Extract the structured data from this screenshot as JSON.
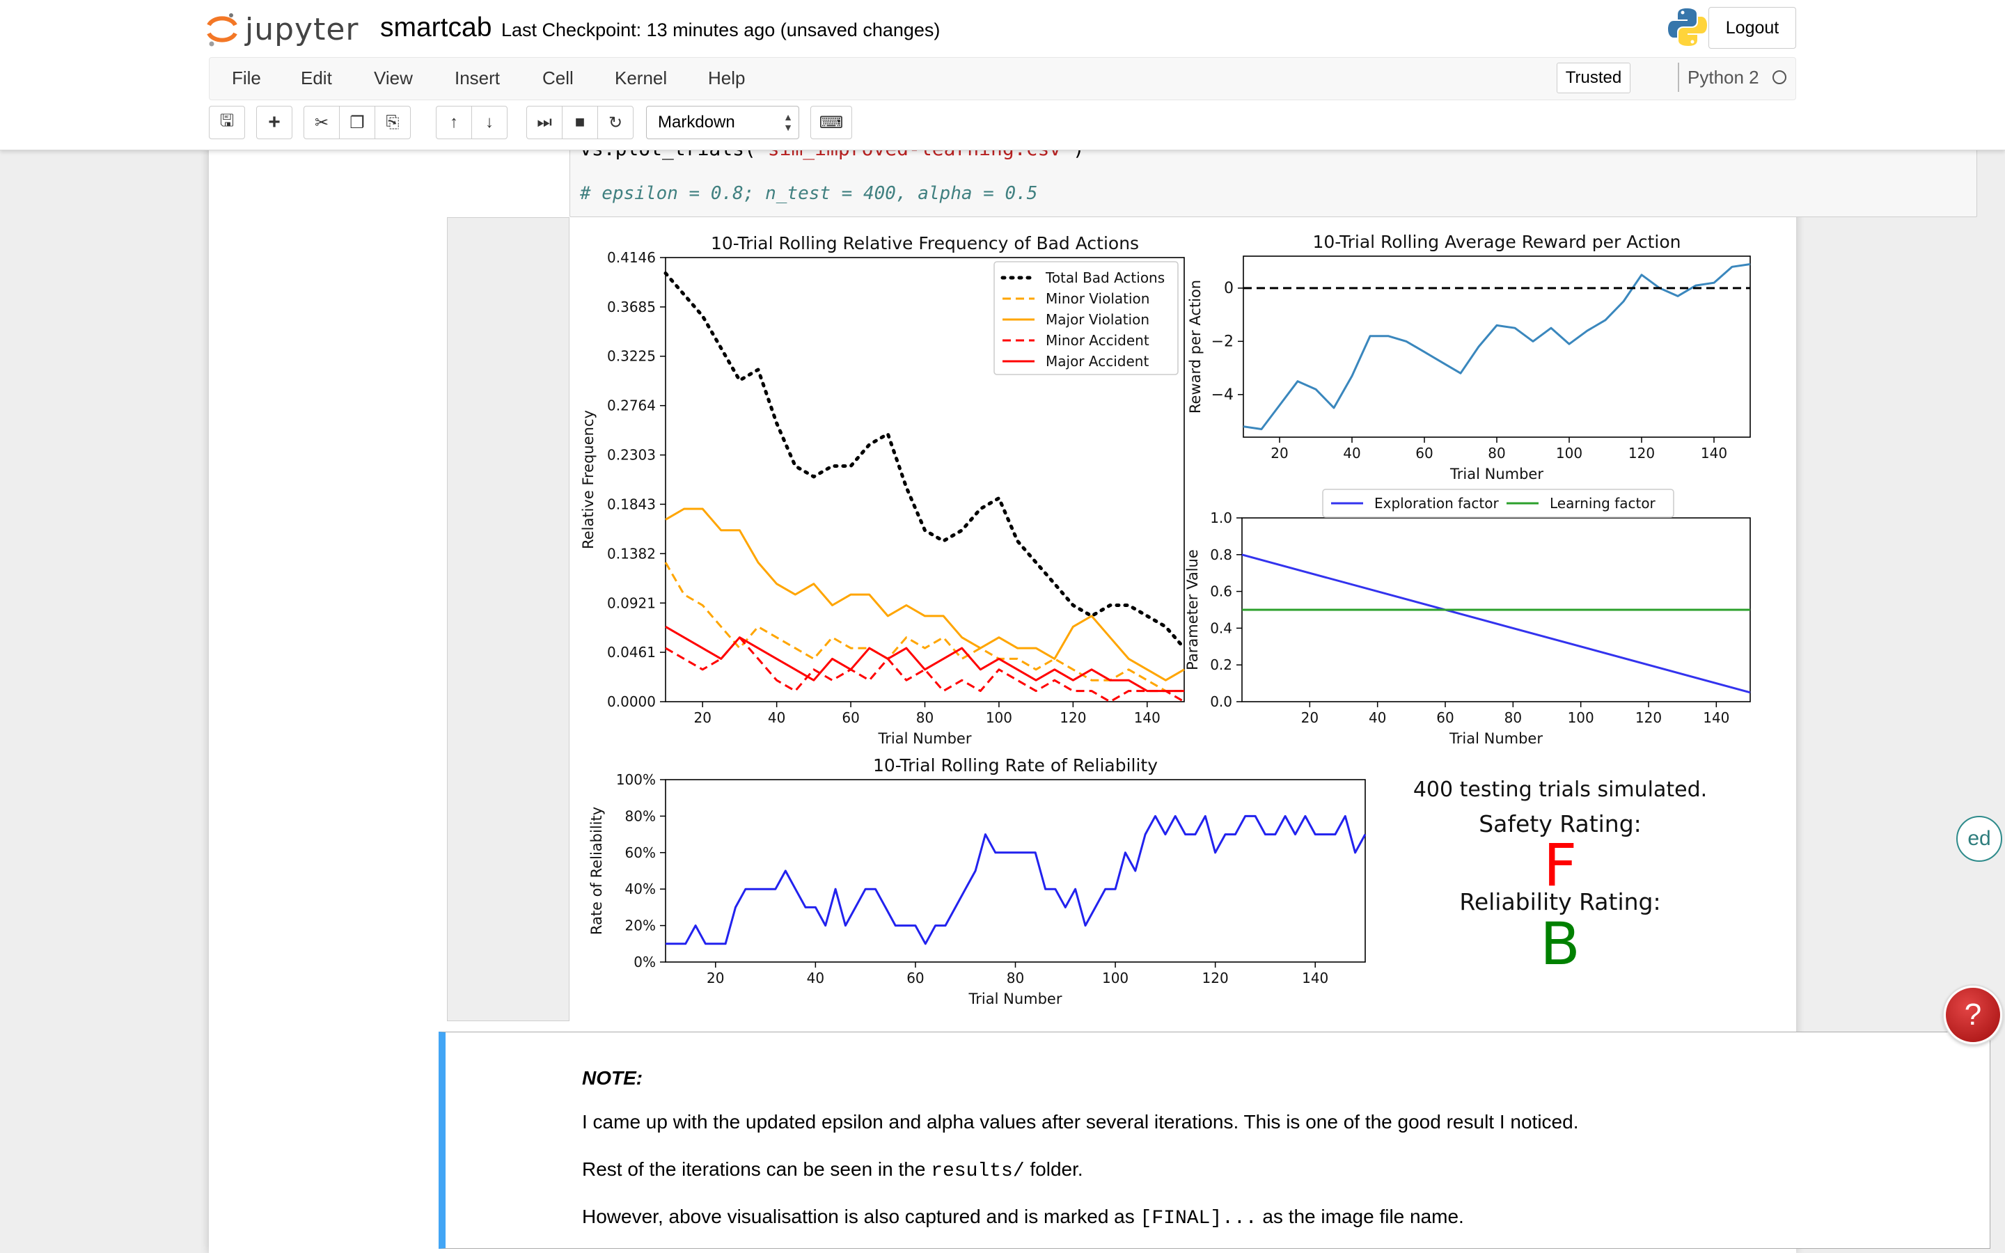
{
  "app": {
    "logo_text": "jupyter",
    "notebook_name": "smartcab",
    "checkpoint": "Last Checkpoint: 13 minutes ago (unsaved changes)",
    "logout_label": "Logout",
    "trusted_label": "Trusted",
    "kernel_name": "Python 2"
  },
  "menu": [
    "File",
    "Edit",
    "View",
    "Insert",
    "Cell",
    "Kernel",
    "Help"
  ],
  "toolbar": {
    "cell_type": "Markdown",
    "icons": [
      "save-icon",
      "plus-icon",
      "cut-icon",
      "copy-icon",
      "paste-icon",
      "arrow-up-icon",
      "arrow-down-icon",
      "run-icon",
      "stop-icon",
      "restart-icon",
      "keyboard-icon"
    ]
  },
  "code_cell": {
    "line_prefix": "vs.plot_trials(",
    "line_string": "'sim_improved-learning.csv'",
    "line_suffix": ")",
    "comment": "# epsilon = 0.8; n_test = 400, alpha = 0.5"
  },
  "chart_data": [
    {
      "type": "line",
      "title": "10-Trial Rolling Relative Frequency of Bad Actions",
      "xlabel": "Trial Number",
      "ylabel": "Relative Frequency",
      "xlim": [
        10,
        150
      ],
      "ylim": [
        0,
        0.4146
      ],
      "yticks": [
        "0.0000",
        "0.0461",
        "0.0921",
        "0.1382",
        "0.1843",
        "0.2303",
        "0.2764",
        "0.3225",
        "0.3685",
        "0.4146"
      ],
      "xticks": [
        "20",
        "40",
        "60",
        "80",
        "100",
        "120",
        "140"
      ],
      "legend": "top-right",
      "x": [
        10,
        15,
        20,
        25,
        30,
        35,
        40,
        45,
        50,
        55,
        60,
        65,
        70,
        75,
        80,
        85,
        90,
        95,
        100,
        105,
        110,
        115,
        120,
        125,
        130,
        135,
        140,
        145,
        150
      ],
      "series": [
        {
          "name": "Total Bad Actions",
          "color": "#000000",
          "style": "dotted",
          "values": [
            0.4,
            0.38,
            0.36,
            0.33,
            0.3,
            0.31,
            0.26,
            0.22,
            0.21,
            0.22,
            0.22,
            0.24,
            0.25,
            0.2,
            0.16,
            0.15,
            0.16,
            0.18,
            0.19,
            0.15,
            0.13,
            0.11,
            0.09,
            0.08,
            0.09,
            0.09,
            0.08,
            0.07,
            0.05
          ]
        },
        {
          "name": "Minor Violation",
          "color": "#ffa500",
          "style": "dashed",
          "values": [
            0.13,
            0.1,
            0.09,
            0.07,
            0.05,
            0.07,
            0.06,
            0.05,
            0.04,
            0.06,
            0.05,
            0.05,
            0.04,
            0.06,
            0.05,
            0.06,
            0.04,
            0.05,
            0.04,
            0.04,
            0.03,
            0.04,
            0.03,
            0.02,
            0.02,
            0.03,
            0.02,
            0.01,
            0.01
          ]
        },
        {
          "name": "Major Violation",
          "color": "#ffa500",
          "style": "solid",
          "values": [
            0.17,
            0.18,
            0.18,
            0.16,
            0.16,
            0.13,
            0.11,
            0.1,
            0.11,
            0.09,
            0.1,
            0.1,
            0.08,
            0.09,
            0.08,
            0.08,
            0.06,
            0.05,
            0.06,
            0.05,
            0.05,
            0.04,
            0.07,
            0.08,
            0.06,
            0.04,
            0.03,
            0.02,
            0.03
          ]
        },
        {
          "name": "Minor Accident",
          "color": "#ff0000",
          "style": "dashed",
          "values": [
            0.05,
            0.04,
            0.03,
            0.04,
            0.06,
            0.04,
            0.02,
            0.01,
            0.03,
            0.02,
            0.03,
            0.02,
            0.04,
            0.02,
            0.03,
            0.01,
            0.02,
            0.01,
            0.03,
            0.02,
            0.01,
            0.02,
            0.01,
            0.01,
            0.0,
            0.01,
            0.01,
            0.01,
            0.0
          ]
        },
        {
          "name": "Major Accident",
          "color": "#ff0000",
          "style": "solid",
          "values": [
            0.07,
            0.06,
            0.05,
            0.04,
            0.06,
            0.05,
            0.04,
            0.03,
            0.02,
            0.04,
            0.03,
            0.05,
            0.04,
            0.05,
            0.03,
            0.04,
            0.05,
            0.03,
            0.04,
            0.03,
            0.02,
            0.03,
            0.02,
            0.03,
            0.02,
            0.02,
            0.01,
            0.01,
            0.01
          ]
        }
      ]
    },
    {
      "type": "line",
      "title": "10-Trial Rolling Average Reward per Action",
      "xlabel": "Trial Number",
      "ylabel": "Reward per Action",
      "xlim": [
        10,
        150
      ],
      "ylim": [
        -5.6,
        1.2
      ],
      "yticks": [
        "0",
        "−2",
        "−4"
      ],
      "xticks": [
        "20",
        "40",
        "60",
        "80",
        "100",
        "120",
        "140"
      ],
      "x": [
        10,
        15,
        20,
        25,
        30,
        35,
        40,
        45,
        50,
        55,
        60,
        65,
        70,
        75,
        80,
        85,
        90,
        95,
        100,
        105,
        110,
        115,
        120,
        125,
        130,
        135,
        140,
        145,
        150
      ],
      "series": [
        {
          "name": "",
          "color": "#3a87bd",
          "style": "solid",
          "values": [
            -5.2,
            -5.3,
            -4.4,
            -3.5,
            -3.8,
            -4.5,
            -3.3,
            -1.8,
            -1.8,
            -2.0,
            -2.4,
            -2.8,
            -3.2,
            -2.2,
            -1.4,
            -1.5,
            -2.0,
            -1.5,
            -2.1,
            -1.6,
            -1.2,
            -0.5,
            0.5,
            0.0,
            -0.3,
            0.1,
            0.2,
            0.8,
            0.9
          ]
        },
        {
          "name": "",
          "color": "#000000",
          "style": "dashed",
          "values": [
            0,
            0,
            0,
            0,
            0,
            0,
            0,
            0,
            0,
            0,
            0,
            0,
            0,
            0,
            0,
            0,
            0,
            0,
            0,
            0,
            0,
            0,
            0,
            0,
            0,
            0,
            0,
            0,
            0
          ]
        }
      ]
    },
    {
      "type": "line",
      "xlabel": "Trial Number",
      "ylabel": "Parameter Value",
      "xlim": [
        0,
        150
      ],
      "ylim": [
        0,
        1.0
      ],
      "yticks": [
        "0.0",
        "0.2",
        "0.4",
        "0.6",
        "0.8",
        "1.0"
      ],
      "xticks": [
        "20",
        "40",
        "60",
        "80",
        "100",
        "120",
        "140"
      ],
      "legend": "top-center",
      "x": [
        0,
        150
      ],
      "series": [
        {
          "name": "Exploration factor",
          "color": "#3333ee",
          "style": "solid",
          "values": [
            0.8,
            0.05
          ]
        },
        {
          "name": "Learning factor",
          "color": "#2ca02c",
          "style": "solid",
          "values": [
            0.5,
            0.5
          ]
        }
      ]
    },
    {
      "type": "line",
      "title": "10-Trial Rolling Rate of Reliability",
      "xlabel": "Trial Number",
      "ylabel": "Rate of Reliability",
      "xlim": [
        10,
        150
      ],
      "ylim": [
        0,
        100
      ],
      "yticks": [
        "0%",
        "20%",
        "40%",
        "60%",
        "80%",
        "100%"
      ],
      "xticks": [
        "20",
        "40",
        "60",
        "80",
        "100",
        "120",
        "140"
      ],
      "x": [
        10,
        12,
        14,
        16,
        18,
        20,
        22,
        24,
        26,
        28,
        30,
        32,
        34,
        36,
        38,
        40,
        42,
        44,
        46,
        48,
        50,
        52,
        54,
        56,
        58,
        60,
        62,
        64,
        66,
        68,
        70,
        72,
        74,
        76,
        78,
        80,
        82,
        84,
        86,
        88,
        90,
        92,
        94,
        96,
        98,
        100,
        102,
        104,
        106,
        108,
        110,
        112,
        114,
        116,
        118,
        120,
        122,
        124,
        126,
        128,
        130,
        132,
        134,
        136,
        138,
        140,
        142,
        144,
        146,
        148,
        150
      ],
      "series": [
        {
          "name": "",
          "color": "#2222ee",
          "style": "solid",
          "values": [
            10,
            10,
            10,
            20,
            10,
            10,
            10,
            30,
            40,
            40,
            40,
            40,
            50,
            40,
            30,
            30,
            20,
            40,
            20,
            30,
            40,
            40,
            30,
            20,
            20,
            20,
            10,
            20,
            20,
            30,
            40,
            50,
            70,
            60,
            60,
            60,
            60,
            60,
            40,
            40,
            30,
            40,
            20,
            30,
            40,
            40,
            60,
            50,
            70,
            80,
            70,
            80,
            70,
            70,
            80,
            60,
            70,
            70,
            80,
            80,
            70,
            70,
            80,
            70,
            80,
            70,
            70,
            70,
            80,
            60,
            70
          ]
        }
      ]
    }
  ],
  "summary": {
    "trials": "400 testing trials simulated.",
    "safety_label": "Safety Rating:",
    "safety_grade": "F",
    "safety_color": "#ff0000",
    "reliability_label": "Reliability Rating:",
    "reliability_grade": "B",
    "reliability_color": "#008000"
  },
  "markdown_cell": {
    "note_label": "NOTE:",
    "line1": "I came up with the updated epsilon and alpha values after several iterations. This is one of the good result I noticed.",
    "line2_pre": "Rest of the iterations can be seen in the ",
    "line2_code": "results/",
    "line2_post": " folder.",
    "line3_pre": "However, above visualisattion is also captured and is marked as ",
    "line3_code": "[FINAL]...",
    "line3_post": " as the image file name."
  },
  "widgets": {
    "ed_label": "ed",
    "help_label": "?"
  }
}
